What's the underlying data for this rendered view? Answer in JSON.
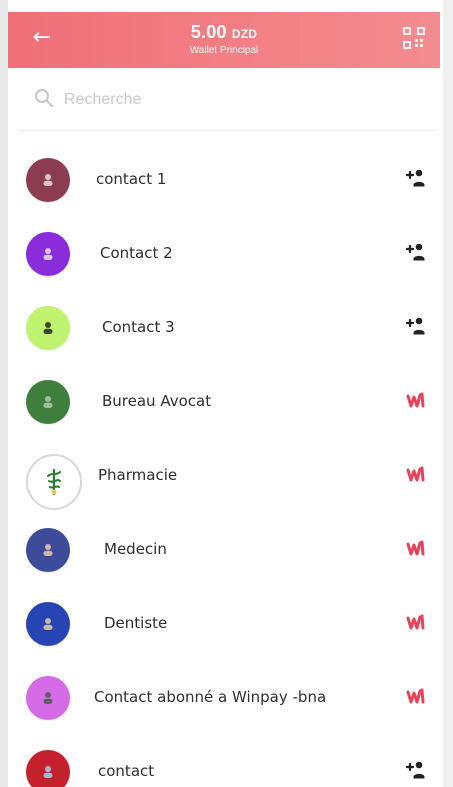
{
  "header": {
    "balance_value": "5.00",
    "balance_currency": "DZD",
    "wallet_label": "Wallet Principal"
  },
  "search": {
    "placeholder": "Recherche"
  },
  "contacts": [
    {
      "name": "contact 1",
      "avatar_color": "#8b3d4f",
      "action": "add-contact-icon"
    },
    {
      "name": "Contact 2",
      "avatar_color": "#8a2bdc",
      "action": "add-contact-icon"
    },
    {
      "name": "Contact 3",
      "avatar_color": "#bff26e",
      "action": "add-contact-icon"
    },
    {
      "name": "Bureau Avocat",
      "avatar_color": "#3f7f3d",
      "action": "winpay-icon"
    },
    {
      "name": "Pharmacie",
      "avatar_color": "#ffffff",
      "action": "winpay-icon"
    },
    {
      "name": "Medecin",
      "avatar_color": "#3d4c9a",
      "action": "winpay-icon"
    },
    {
      "name": "Dentiste",
      "avatar_color": "#2644b4",
      "action": "winpay-icon"
    },
    {
      "name": "Contact abonné a Winpay -bna",
      "avatar_color": "#d56ae7",
      "action": "winpay-icon"
    },
    {
      "name": "contact",
      "avatar_color": "#c6202c",
      "action": "add-contact-icon"
    }
  ],
  "colors": {
    "header_start": "#f06f78",
    "header_end": "#f48c8f",
    "winpay": "#e6445a",
    "add_contact": "#222222"
  }
}
